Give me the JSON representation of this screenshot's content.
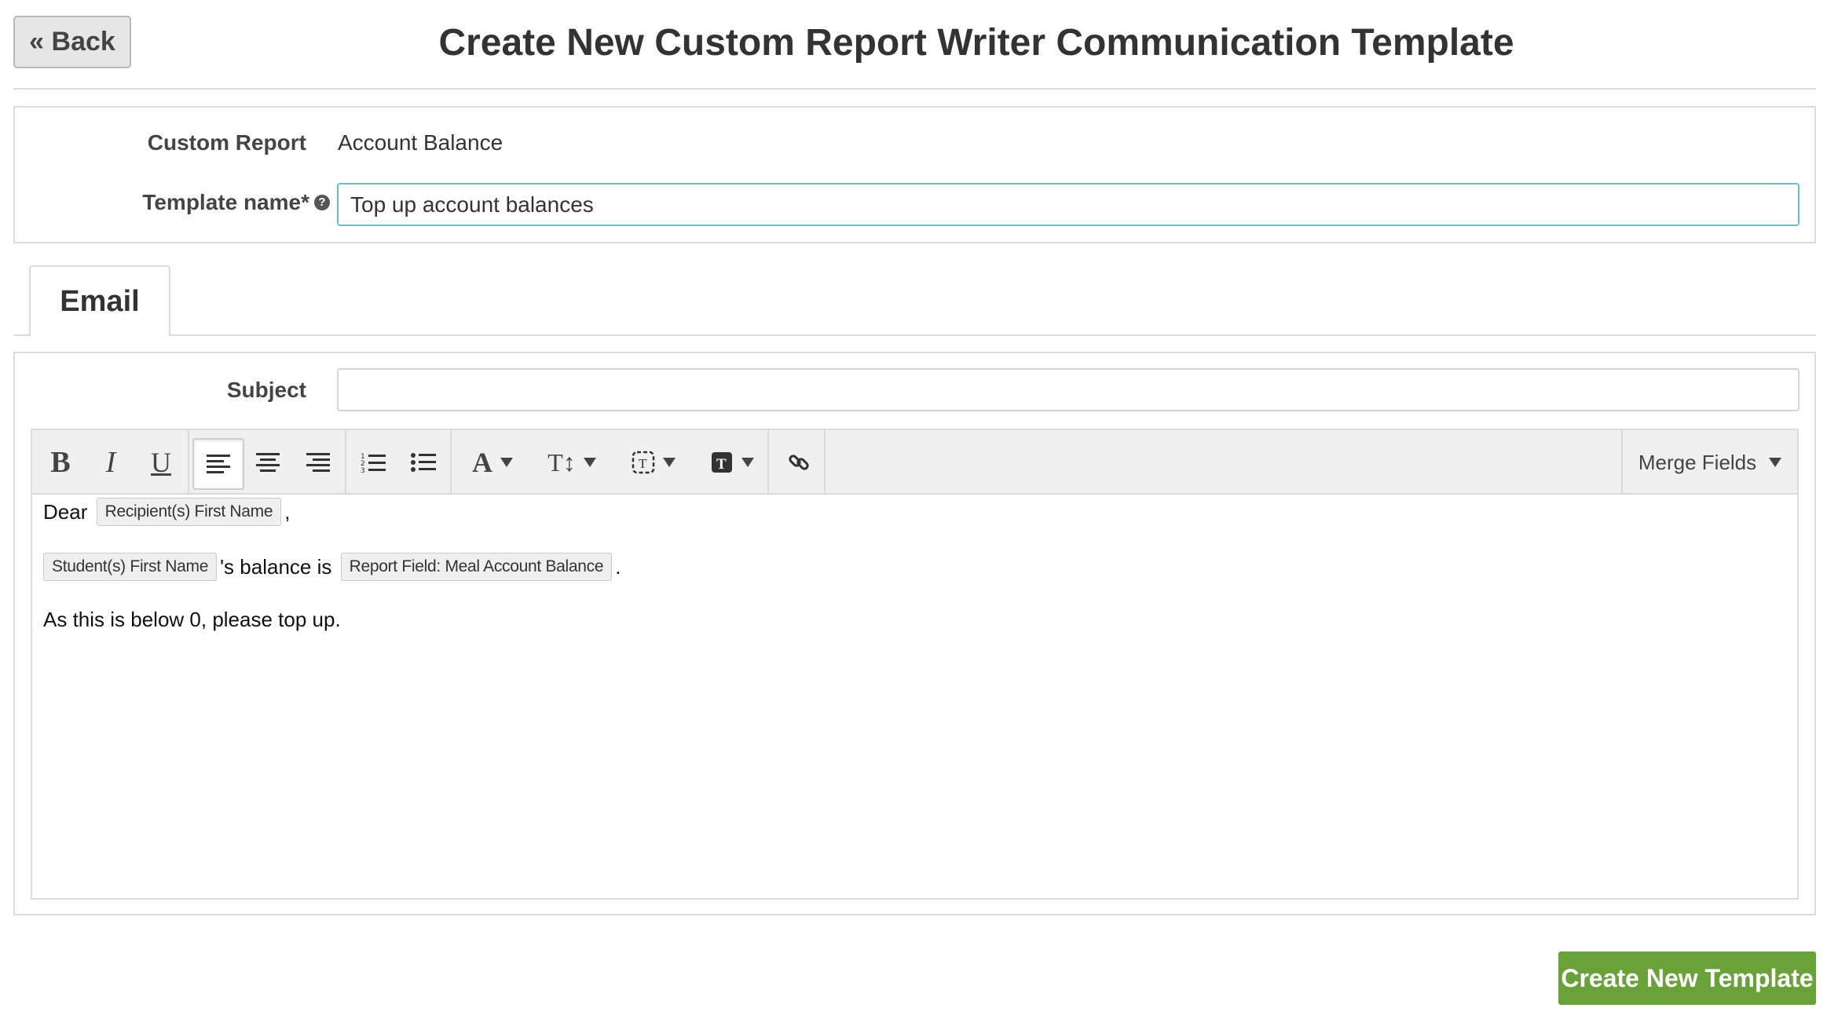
{
  "header": {
    "back_label": "« Back",
    "title": "Create New Custom Report Writer Communication Template"
  },
  "form": {
    "custom_report_label": "Custom Report",
    "custom_report_value": "Account Balance",
    "template_name_label": "Template name*",
    "template_name_value": "Top up account balances",
    "help_icon_glyph": "?"
  },
  "tabs": [
    {
      "label": "Email",
      "active": true
    }
  ],
  "email": {
    "subject_label": "Subject",
    "subject_value": "",
    "toolbar": {
      "bold": "B",
      "italic": "I",
      "underline": "U",
      "font_color": "A",
      "font_size": "T↕",
      "merge_fields_label": "Merge Fields"
    },
    "body": {
      "line1_prefix": "Dear ",
      "line1_chip": "Recipient(s) First Name",
      "line1_suffix": ",",
      "line2_chip1": "Student(s) First Name",
      "line2_middle": "'s balance is ",
      "line2_chip2": "Report Field: Meal Account Balance",
      "line2_suffix": ".",
      "line3": "As this is below 0, please top up."
    }
  },
  "footer": {
    "create_label": "Create New Template"
  },
  "colors": {
    "accent_green": "#6aa23a",
    "focus_border": "#5bc3d4",
    "border_gray": "#dcdcdc"
  }
}
